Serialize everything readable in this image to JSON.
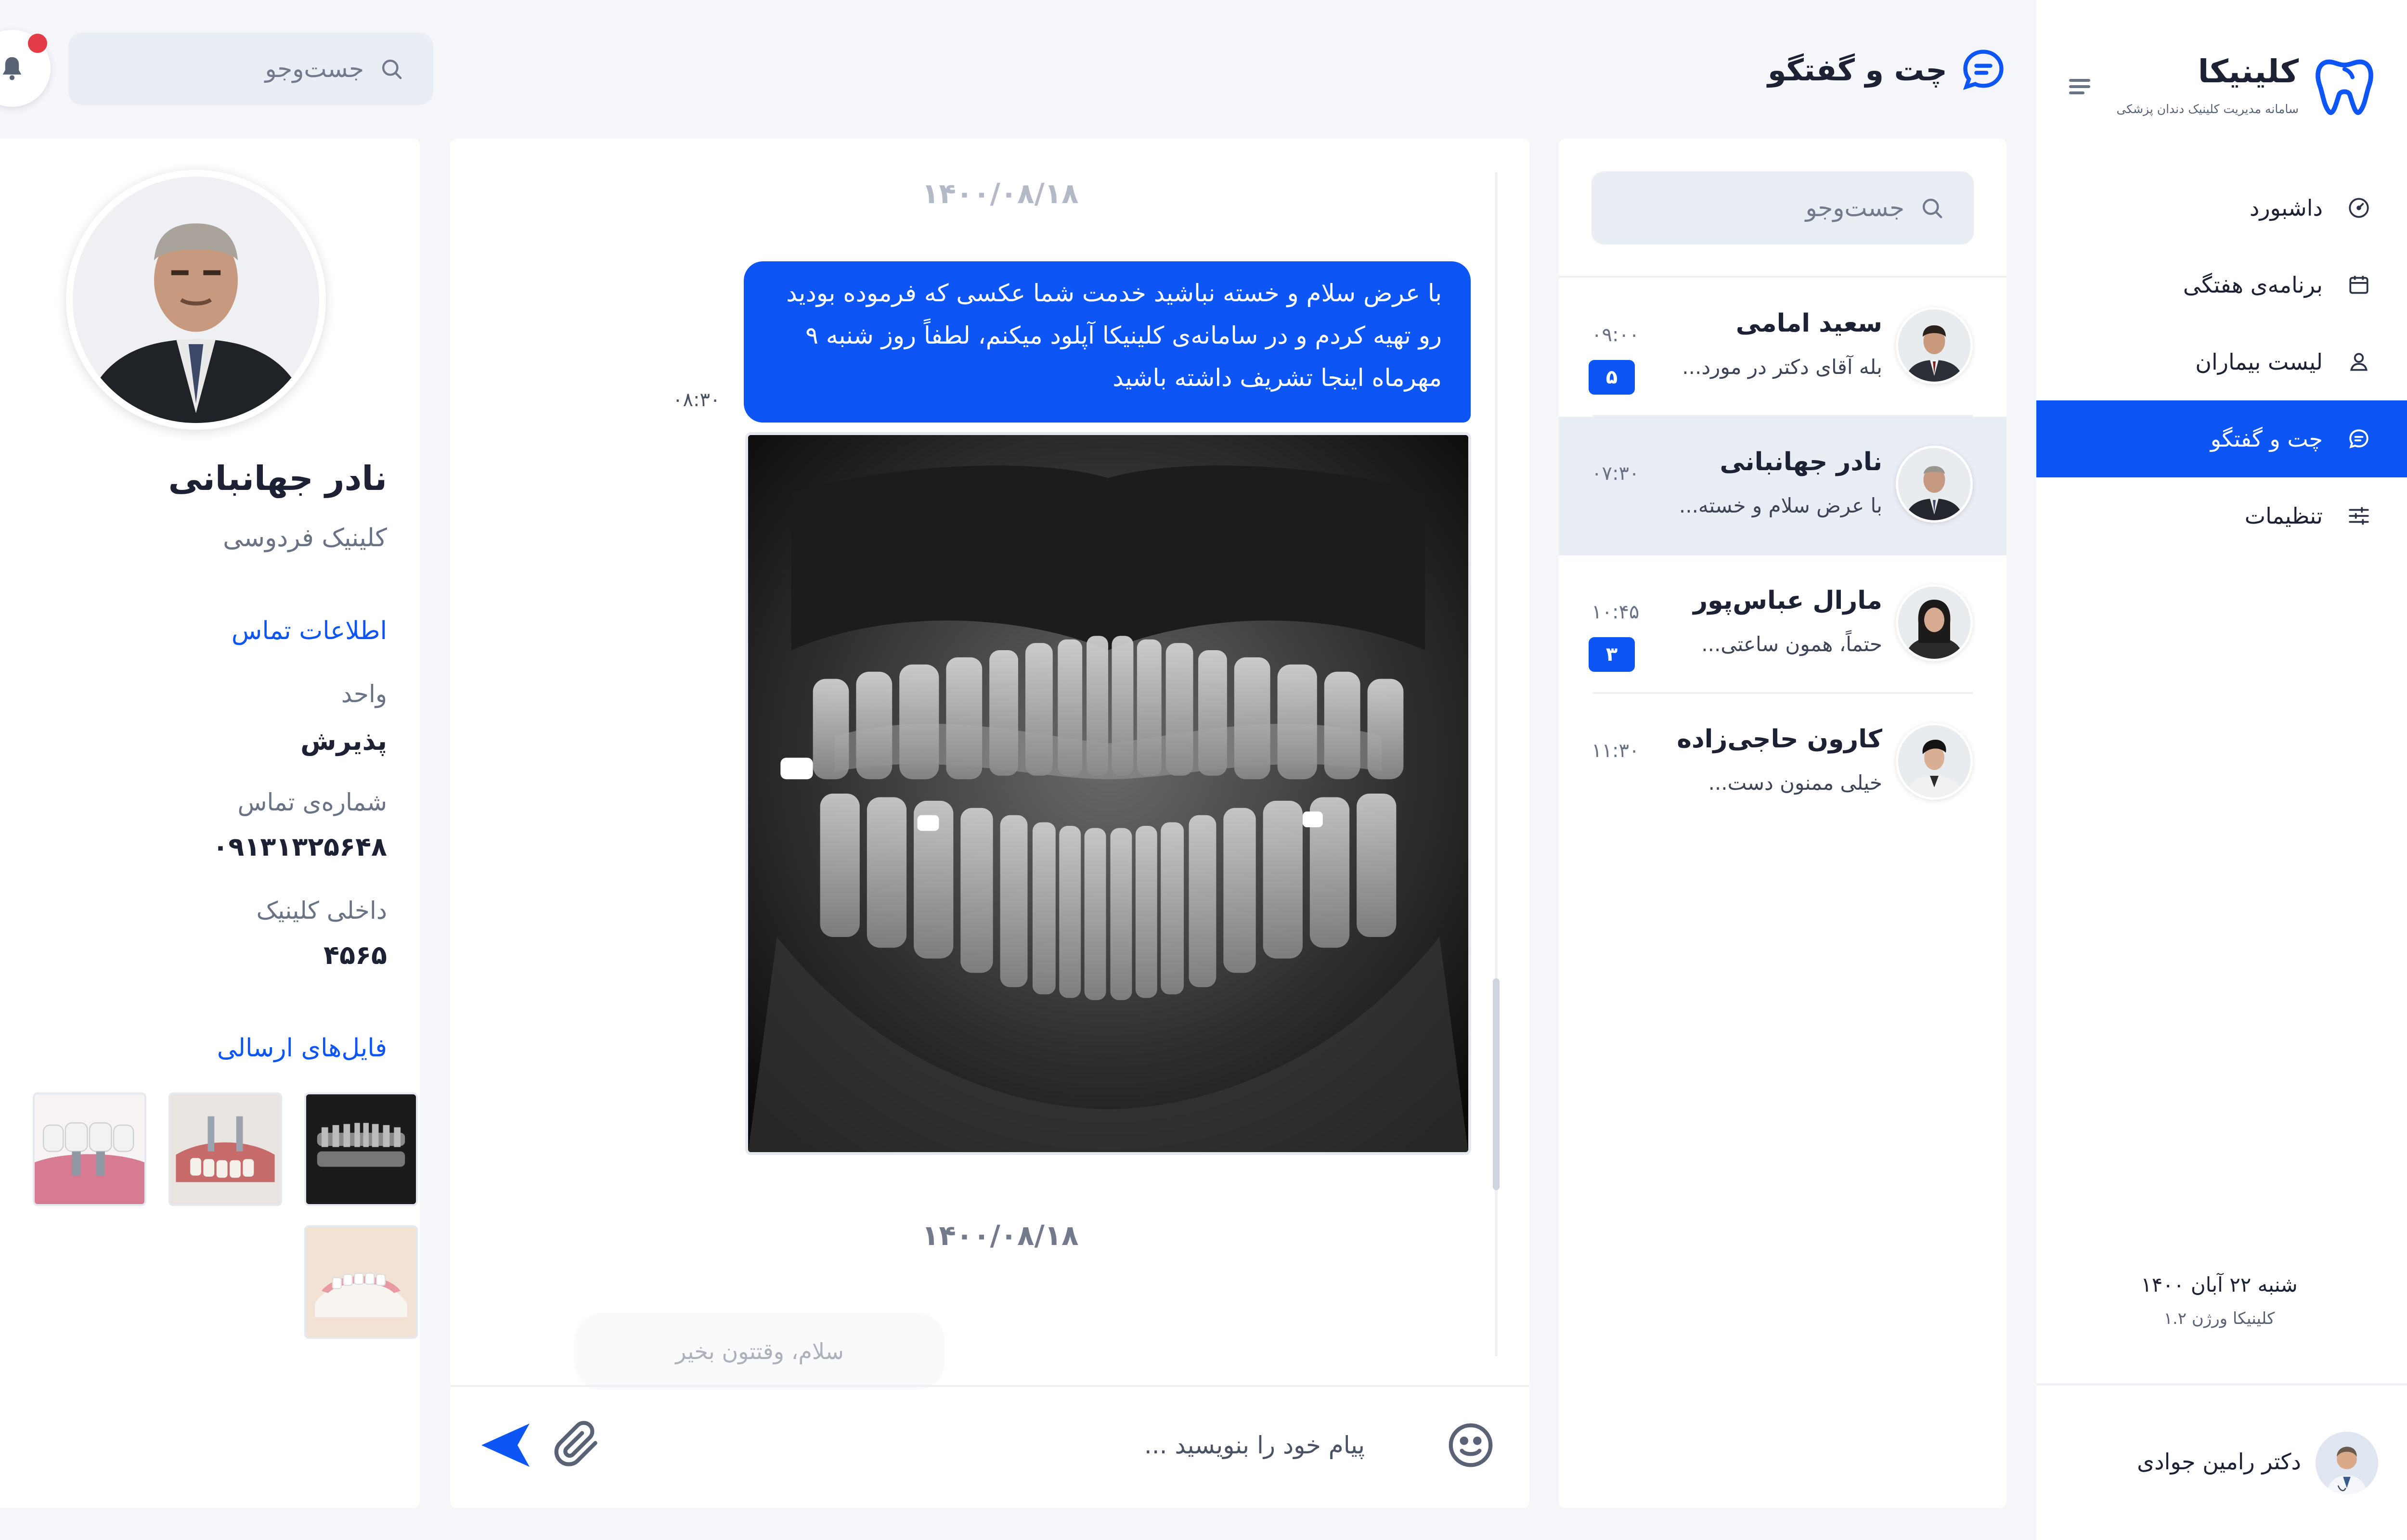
{
  "sidebar": {
    "brand_name": "کلینیکا",
    "brand_subtitle": "سامانه مدیریت کلینیک دندان پزشکی",
    "items": [
      {
        "label": "داشبورد",
        "icon": "dashboard-icon"
      },
      {
        "label": "برنامه‌ی هفتگی",
        "icon": "calendar-icon"
      },
      {
        "label": "لیست بیماران",
        "icon": "user-icon"
      },
      {
        "label": "چت و گفتگو",
        "icon": "chat-icon",
        "active": true
      },
      {
        "label": "تنظیمات",
        "icon": "settings-sliders-icon"
      }
    ],
    "date": "شنبه ۲۲ آبان ۱۴۰۰",
    "version": "کلینیکا ورژن ۱.۲",
    "user_name": "دکتر رامین جوادی"
  },
  "header": {
    "title": "چت و گفتگو",
    "search_placeholder": "جست‌وجو",
    "has_notification": true
  },
  "conversations": {
    "search_placeholder": "جست‌وجو",
    "items": [
      {
        "name": "سعید امامی",
        "preview": "بله آقای دکتر در مورد...",
        "time": "۰۹:۰۰",
        "unread": "۵",
        "selected": false
      },
      {
        "name": "نادر جهانبانی",
        "preview": "با عرض سلام و خسته...",
        "time": "۰۷:۳۰",
        "unread": "",
        "selected": true
      },
      {
        "name": "مارال عباس‌پور",
        "preview": "حتماً، همون ساعتی...",
        "time": "۱۰:۴۵",
        "unread": "۳",
        "selected": false
      },
      {
        "name": "کارون حاجی‌زاده",
        "preview": "خیلی ممنون دست...",
        "time": "۱۱:۳۰",
        "unread": "",
        "selected": false
      }
    ]
  },
  "chat": {
    "date_1": "۱۴۰۰/۰۸/۱۸",
    "message_text": "با عرض سلام و خسته نباشید خدمت شما عکسی که فرموده بودید رو تهیه کردم و در سامانه‌ی کلینیکا آپلود میکنم، لطفاً روز شنبه ۹ مهرماه اینجا تشریف داشته باشید",
    "message_time": "۰۸:۳۰",
    "date_2": "۱۴۰۰/۰۸/۱۸",
    "incoming_text": "سلام، وقتتون بخیر",
    "composer_placeholder": "پیام خود را بنویسید ..."
  },
  "profile": {
    "name": "نادر جهانبانی",
    "clinic": "کلینیک فردوسی",
    "contact_title": "اطلاعات تماس",
    "unit_label": "واحد",
    "unit_value": "پذیرش",
    "phone_label": "شماره‌ی تماس",
    "phone_value": "۰۹۱۳۱۳۲۵۶۴۸",
    "ext_label": "داخلی کلینیک",
    "ext_value": "۴۵۶۵",
    "files_title": "فایل‌های ارسالی"
  },
  "colors": {
    "accent": "#0d55f5",
    "background": "#f4f6fa",
    "panel": "#ffffff",
    "notification": "#e53b46"
  }
}
